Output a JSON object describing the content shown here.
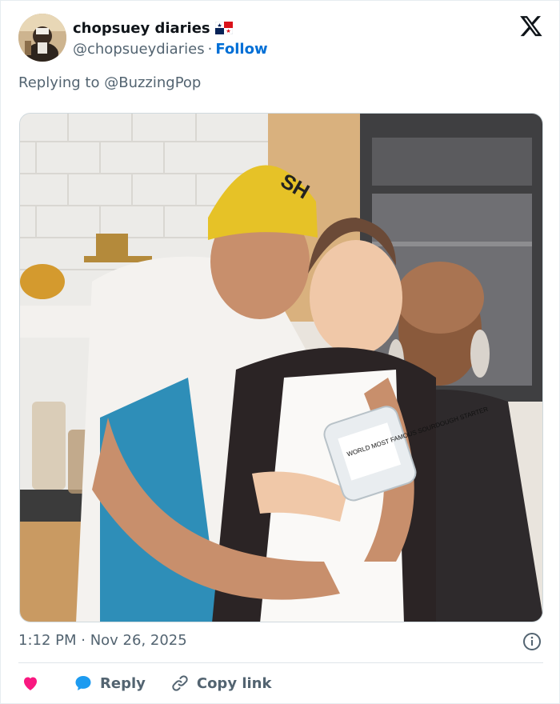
{
  "account": {
    "display_name": "chopsuey diaries",
    "handle": "@chopsueydiaries",
    "separator": "·",
    "follow_label": "Follow",
    "flag_emoji_name": "panama-flag-icon"
  },
  "reply_context": {
    "prefix": "Replying to",
    "mention": "@BuzzingPop"
  },
  "photo": {
    "jar_label_text": "WORLD MOST FAMOUS SOURDOUGH STARTER",
    "beanie_text": "SH"
  },
  "meta": {
    "timestamp": "1:12 PM · Nov 26, 2025"
  },
  "actions": {
    "reply_label": "Reply",
    "copy_link_label": "Copy link"
  },
  "colors": {
    "follow_blue": "#006fd6",
    "heart_pink": "#f91880",
    "reply_blue": "#1d9bf0",
    "muted_text": "#536471"
  }
}
